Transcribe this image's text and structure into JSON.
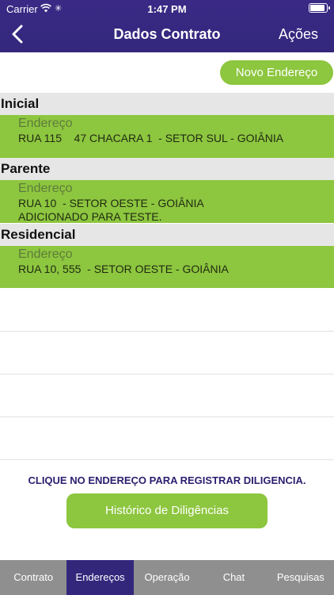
{
  "status_bar": {
    "carrier": "Carrier",
    "time": "1:47 PM"
  },
  "nav": {
    "title": "Dados Contrato",
    "action": "Ações"
  },
  "new_address_button": "Novo Endereço",
  "sections": [
    {
      "title": "Inicial",
      "label": "Endereço",
      "lines": [
        "RUA 115    47 CHACARA 1  - SETOR SUL - GOIÂNIA"
      ]
    },
    {
      "title": "Parente",
      "label": "Endereço",
      "lines": [
        "RUA 10  - SETOR OESTE - GOIÂNIA",
        "ADICIONADO PARA TESTE."
      ]
    },
    {
      "title": "Residencial",
      "label": "Endereço",
      "lines": [
        "RUA 10, 555  - SETOR OESTE - GOIÂNIA"
      ]
    }
  ],
  "hint": "CLIQUE NO ENDEREÇO PARA REGISTRAR DILIGENCIA.",
  "history_button": "Histórico de Diligências",
  "tabs": [
    "Contrato",
    "Endereços",
    "Operação",
    "Chat",
    "Pesquisas"
  ],
  "active_tab": "Endereços",
  "colors": {
    "nav_bg": "#33277c",
    "accent_green": "#8dc63f",
    "section_header_bg": "#e6e6e6",
    "tabbar_bg": "#8f8f8f"
  }
}
